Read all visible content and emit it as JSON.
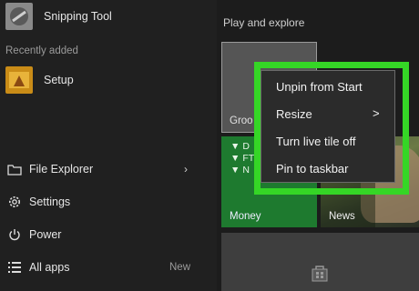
{
  "start_menu": {
    "app_list": {
      "snipping_tool": "Snipping Tool",
      "recently_added_header": "Recently added",
      "setup": "Setup"
    },
    "system_items": {
      "file_explorer": "File Explorer",
      "settings": "Settings",
      "power": "Power",
      "all_apps": "All apps",
      "all_apps_badge": "New"
    },
    "tiles": {
      "section_header": "Play and explore",
      "groove_partial": "Groo",
      "money": "Money",
      "news": "News",
      "money_ticker_prefix": [
        "D",
        "FT",
        "N"
      ]
    }
  },
  "context_menu": {
    "items": [
      "Unpin from Start",
      "Resize",
      "Turn live tile off",
      "Pin to taskbar"
    ],
    "resize_arrow": ">"
  },
  "colors": {
    "highlight_outline": "#35d626",
    "money_tile": "#1e7a2f"
  }
}
